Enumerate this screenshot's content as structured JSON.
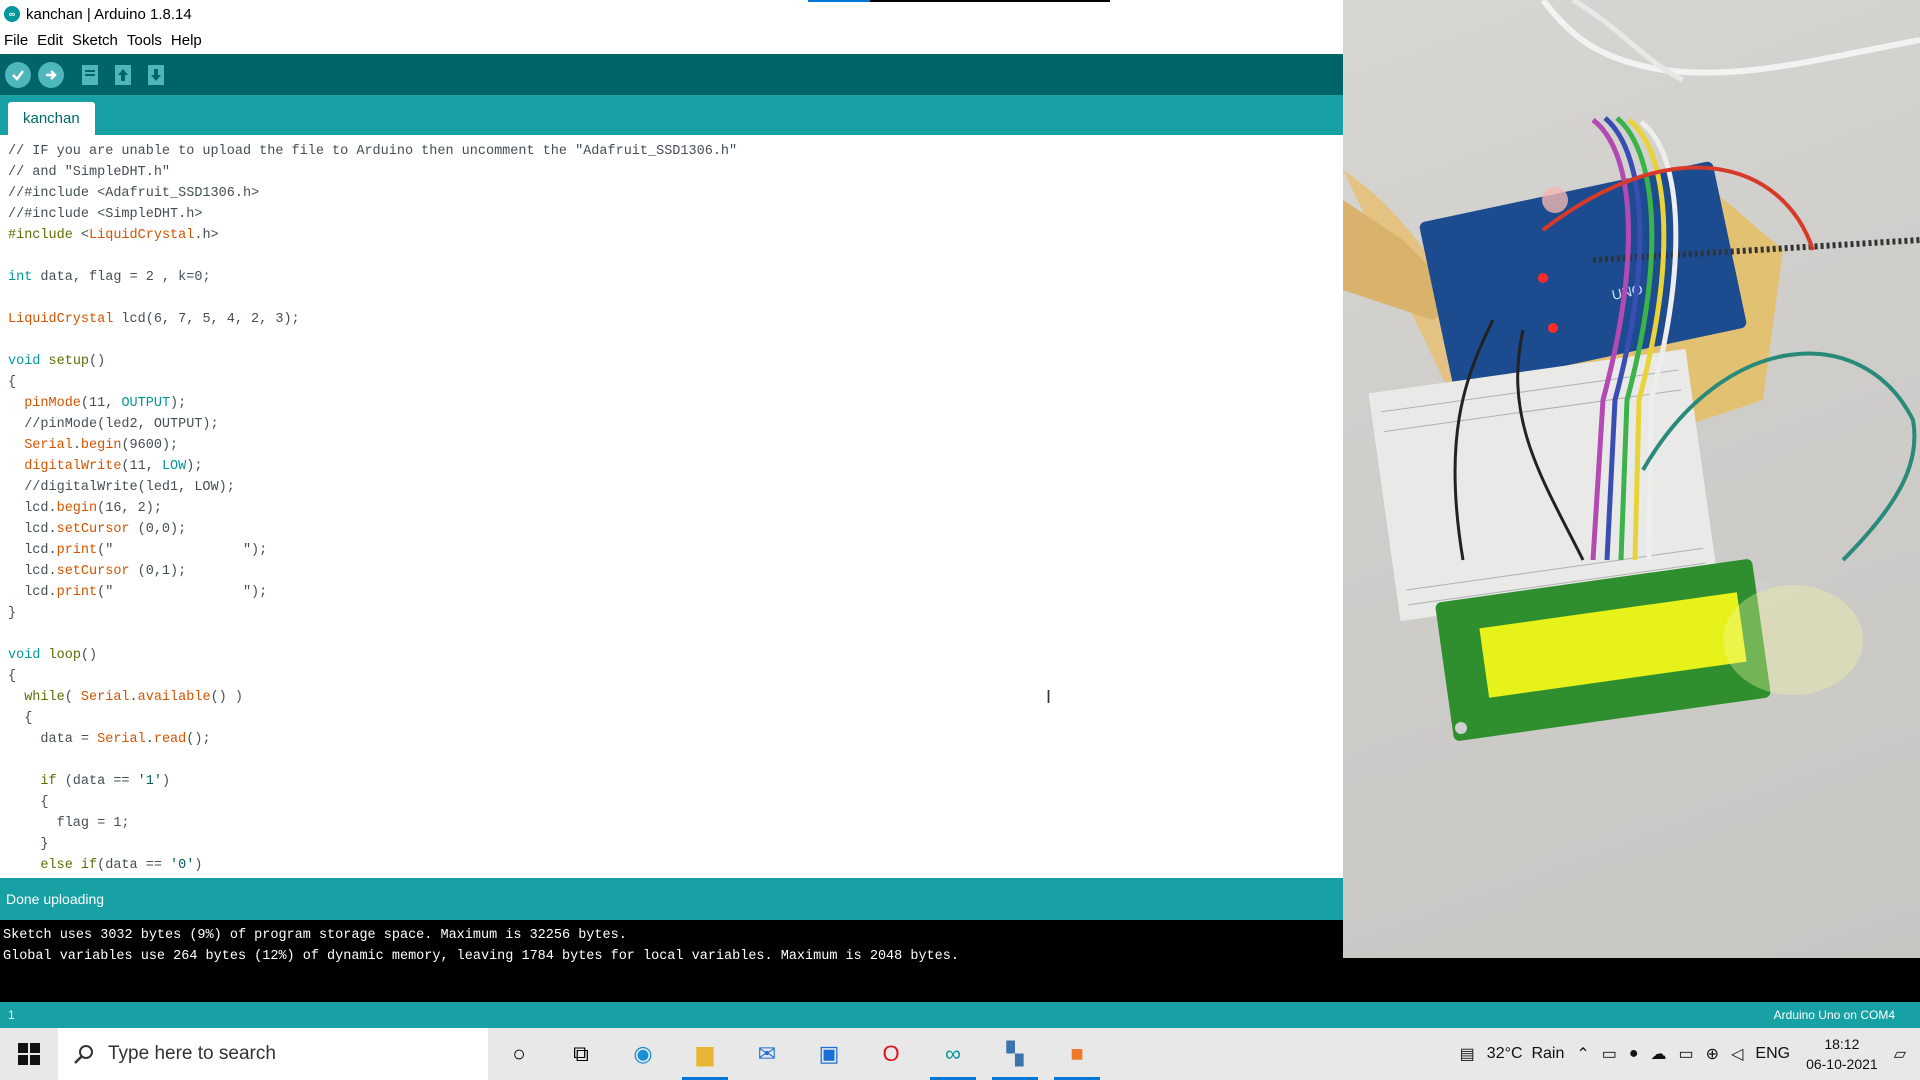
{
  "window": {
    "title": "kanchan | Arduino 1.8.14"
  },
  "menu": [
    "File",
    "Edit",
    "Sketch",
    "Tools",
    "Help"
  ],
  "toolbar": {
    "verify": "Verify",
    "upload": "Upload",
    "new": "New",
    "open": "Open",
    "save": "Save"
  },
  "tab": {
    "label": "kanchan"
  },
  "code_lines": [
    [
      [
        "c",
        "// IF you are unable to upload the file to Arduino then uncomment the \"Adafruit_SSD1306.h\""
      ]
    ],
    [
      [
        "c",
        "// and \"SimpleDHT.h\""
      ]
    ],
    [
      [
        "c",
        "//#include <Adafruit_SSD1306.h>"
      ]
    ],
    [
      [
        "c",
        "//#include <SimpleDHT.h>"
      ]
    ],
    [
      [
        "kw",
        "#include "
      ],
      [
        "c",
        "<"
      ],
      [
        "ty",
        "LiquidCrystal"
      ],
      [
        "c",
        ".h>"
      ]
    ],
    [
      [
        "c",
        ""
      ]
    ],
    [
      [
        "k",
        "int"
      ],
      [
        "c",
        " data, flag = 2 , k=0;"
      ]
    ],
    [
      [
        "c",
        ""
      ]
    ],
    [
      [
        "ty",
        "LiquidCrystal"
      ],
      [
        "c",
        " lcd(6, 7, 5, 4, 2, 3);"
      ]
    ],
    [
      [
        "c",
        ""
      ]
    ],
    [
      [
        "k",
        "void"
      ],
      [
        "c",
        " "
      ],
      [
        "kw",
        "setup"
      ],
      [
        "c",
        "()"
      ]
    ],
    [
      [
        "c",
        "{"
      ]
    ],
    [
      [
        "c",
        "  "
      ],
      [
        "fn",
        "pinMode"
      ],
      [
        "c",
        "(11, "
      ],
      [
        "cst",
        "OUTPUT"
      ],
      [
        "c",
        ");"
      ]
    ],
    [
      [
        "c",
        "  //pinMode(led2, OUTPUT);"
      ]
    ],
    [
      [
        "c",
        "  "
      ],
      [
        "fn",
        "Serial"
      ],
      [
        "c",
        "."
      ],
      [
        "fn",
        "begin"
      ],
      [
        "c",
        "(9600);"
      ]
    ],
    [
      [
        "c",
        "  "
      ],
      [
        "fn",
        "digitalWrite"
      ],
      [
        "c",
        "(11, "
      ],
      [
        "cst",
        "LOW"
      ],
      [
        "c",
        ");"
      ]
    ],
    [
      [
        "c",
        "  //digitalWrite(led1, LOW);"
      ]
    ],
    [
      [
        "c",
        "  lcd."
      ],
      [
        "fn",
        "begin"
      ],
      [
        "c",
        "(16, 2);"
      ]
    ],
    [
      [
        "c",
        "  lcd."
      ],
      [
        "fn",
        "setCursor"
      ],
      [
        "c",
        " (0,0);"
      ]
    ],
    [
      [
        "c",
        "  lcd."
      ],
      [
        "fn",
        "print"
      ],
      [
        "c",
        "(\"                "
      ],
      [
        "c",
        "\");"
      ]
    ],
    [
      [
        "c",
        "  lcd."
      ],
      [
        "fn",
        "setCursor"
      ],
      [
        "c",
        " (0,1);"
      ]
    ],
    [
      [
        "c",
        "  lcd."
      ],
      [
        "fn",
        "print"
      ],
      [
        "c",
        "(\"                "
      ],
      [
        "c",
        "\");"
      ]
    ],
    [
      [
        "c",
        "}"
      ]
    ],
    [
      [
        "c",
        ""
      ]
    ],
    [
      [
        "k",
        "void"
      ],
      [
        "c",
        " "
      ],
      [
        "kw",
        "loop"
      ],
      [
        "c",
        "()"
      ]
    ],
    [
      [
        "c",
        "{"
      ]
    ],
    [
      [
        "c",
        "  "
      ],
      [
        "kw",
        "while"
      ],
      [
        "c",
        "( "
      ],
      [
        "fn",
        "Serial"
      ],
      [
        "c",
        "."
      ],
      [
        "fn",
        "available"
      ],
      [
        "c",
        "() )"
      ]
    ],
    [
      [
        "c",
        "  {"
      ]
    ],
    [
      [
        "c",
        "    data = "
      ],
      [
        "fn",
        "Serial"
      ],
      [
        "c",
        "."
      ],
      [
        "fn",
        "read"
      ],
      [
        "c",
        "();"
      ]
    ],
    [
      [
        "c",
        ""
      ]
    ],
    [
      [
        "c",
        "    "
      ],
      [
        "kw",
        "if"
      ],
      [
        "c",
        " (data == "
      ],
      [
        "str",
        "'1'"
      ],
      [
        "c",
        ")"
      ]
    ],
    [
      [
        "c",
        "    {"
      ]
    ],
    [
      [
        "c",
        "      flag = 1;"
      ]
    ],
    [
      [
        "c",
        "    }"
      ]
    ],
    [
      [
        "c",
        "    "
      ],
      [
        "kw",
        "else"
      ],
      [
        "c",
        " "
      ],
      [
        "kw",
        "if"
      ],
      [
        "c",
        "(data == "
      ],
      [
        "str",
        "'0'"
      ],
      [
        "c",
        ")"
      ]
    ]
  ],
  "status": {
    "message": "Done uploading"
  },
  "console_lines": [
    "Sketch uses 3032 bytes (9%) of program storage space. Maximum is 32256 bytes.",
    "Global variables use 264 bytes (12%) of dynamic memory, leaving 1784 bytes for local variables. Maximum is 2048 bytes."
  ],
  "footer": {
    "line_number": "1",
    "board": "Arduino Uno on COM4"
  },
  "taskbar": {
    "search_placeholder": "Type here to search",
    "weather": "32°C  Rain",
    "language": "ENG",
    "time": "18:12",
    "date": "06-10-2021"
  },
  "colors": {
    "toolbar": "#006468",
    "tabbar": "#17a1a5",
    "console": "#000000"
  }
}
